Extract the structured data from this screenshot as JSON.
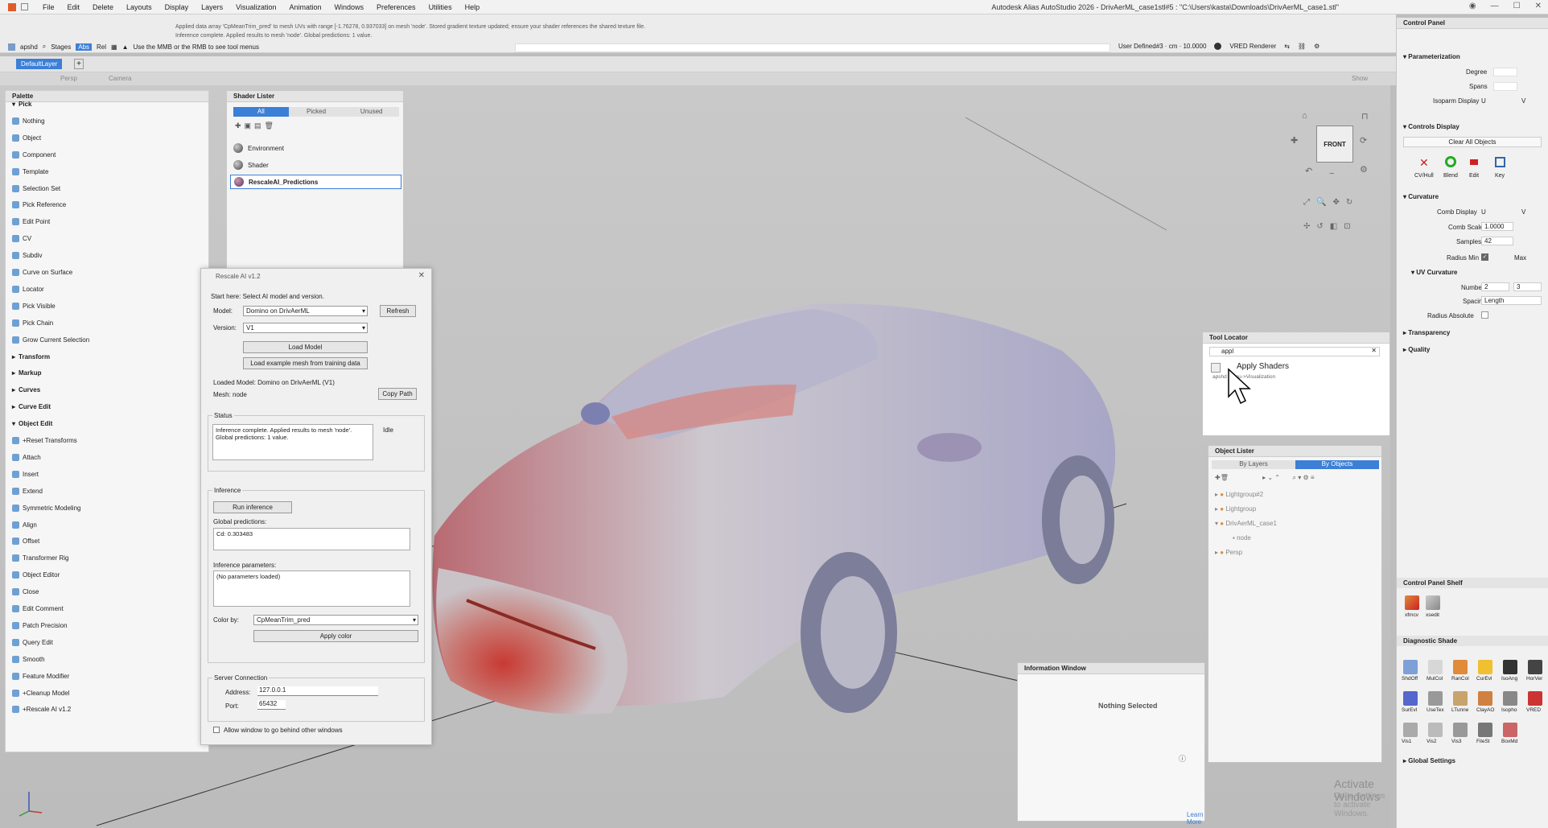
{
  "menubar": {
    "items": [
      "File",
      "Edit",
      "Delete",
      "Layouts",
      "Display",
      "Layers",
      "Visualization",
      "Animation",
      "Windows",
      "Preferences",
      "Utilities",
      "Help"
    ],
    "app_title": "Autodesk Alias AutoStudio 2026   -   DrivAerML_case1stl#5 : \"C:\\Users\\kasta\\Downloads\\DrivAerML_case1.stl\""
  },
  "toolbar": {
    "shelf_label": "apshd",
    "stages_label": "Stages",
    "abs_label": "Abs",
    "rel_label": "Rel",
    "hint": "Use the MMB or the RMB to see tool menus",
    "messages": [
      "Applied data array 'CpMeanTrim_pred' to mesh UVs with range [-1.76278, 0.937033] on mesh 'node'. Stored gradient texture updated; ensure your shader references the shared texture file.",
      "Inference complete. Applied results to mesh 'node'. Global predictions: 1 value."
    ],
    "right_info": "User Defined#3  ·  cm  ·  10.0000",
    "renderer": "VRED Renderer"
  },
  "layer_bar": {
    "default_layer": "DefaultLayer"
  },
  "viewport_bar": {
    "persp": "Persp",
    "camera": "Camera",
    "show": "Show"
  },
  "palette": {
    "title": "Palette",
    "rows": [
      {
        "label": "Pick",
        "header": true
      },
      {
        "label": "Nothing"
      },
      {
        "label": "Object"
      },
      {
        "label": "Component"
      },
      {
        "label": "Template"
      },
      {
        "label": "Selection Set"
      },
      {
        "label": "Pick Reference"
      },
      {
        "label": "Edit Point"
      },
      {
        "label": "CV"
      },
      {
        "label": "Subdiv"
      },
      {
        "label": "Curve on Surface"
      },
      {
        "label": "Locator"
      },
      {
        "label": "Pick Visible"
      },
      {
        "label": "Pick Chain"
      },
      {
        "label": "Grow Current Selection"
      },
      {
        "label": "Transform",
        "header": true
      },
      {
        "label": "Markup",
        "header": true
      },
      {
        "label": "Curves",
        "header": true
      },
      {
        "label": "Curve Edit",
        "header": true
      },
      {
        "label": "Object Edit",
        "header": true
      },
      {
        "label": "+Reset Transforms"
      },
      {
        "label": "Attach"
      },
      {
        "label": "Insert"
      },
      {
        "label": "Extend"
      },
      {
        "label": "Symmetric Modeling"
      },
      {
        "label": "Align"
      },
      {
        "label": "Offset"
      },
      {
        "label": "Transformer Rig"
      },
      {
        "label": "Object Editor"
      },
      {
        "label": "Close"
      },
      {
        "label": "Edit Comment"
      },
      {
        "label": "Patch Precision"
      },
      {
        "label": "Query Edit"
      },
      {
        "label": "Smooth"
      },
      {
        "label": "Feature Modifier"
      },
      {
        "label": "+Cleanup Model"
      },
      {
        "label": "+Rescale AI v1.2"
      }
    ]
  },
  "shader_lister": {
    "title": "Shader Lister",
    "tabs": [
      "All",
      "Picked",
      "Unused"
    ],
    "items": [
      "Environment",
      "Shader",
      "RescaleAI_Predictions"
    ]
  },
  "rescale_dialog": {
    "title": "Rescale AI v1.2",
    "start_here": "Start here: Select AI model and version.",
    "model_label": "Model:",
    "model_value": "Domino on DrivAerML",
    "refresh": "Refresh",
    "version_label": "Version:",
    "version_value": "V1",
    "load_model": "Load Model",
    "load_example": "Load example mesh from training data",
    "loaded_model": "Loaded Model: Domino on DrivAerML (V1)",
    "mesh": "Mesh: node",
    "copy_path": "Copy Path",
    "status_title": "Status",
    "status_text": "Inference complete. Applied results to mesh 'node'. Global predictions: 1 value.",
    "status_state": "Idle",
    "inference_title": "Inference",
    "run_inference": "Run inference",
    "global_predictions_label": "Global predictions:",
    "global_predictions_value": "Cd: 0.303483",
    "inference_params_label": "Inference parameters:",
    "inference_params_value": "(No parameters loaded)",
    "color_by_label": "Color by:",
    "color_by_value": "CpMeanTrim_pred",
    "apply_color": "Apply color",
    "server_title": "Server Connection",
    "address_label": "Address:",
    "address_value": "127.0.0.1",
    "port_label": "Port:",
    "port_value": "65432",
    "allow_behind": "Allow window to go behind other windows"
  },
  "control_panel": {
    "title": "Control Panel",
    "parameterization": "Parameterization",
    "degree": "Degree",
    "spans": "Spans",
    "isoparm_display": "Isoparm Display",
    "u": "U",
    "v": "V",
    "controls_display": "Controls Display",
    "clear_all": "Clear All Objects",
    "icons": [
      "CV/Hull",
      "Blend",
      "Edit",
      "Key"
    ],
    "curvature": "Curvature",
    "comb_display": "Comb Display",
    "comb_scale_label": "Comb Scale",
    "comb_scale": "1.0000",
    "samples_label": "Samples",
    "samples": "42",
    "radius_min": "Radius Min",
    "max": "Max",
    "uv_curvature": "UV Curvature",
    "number_label": "Number",
    "number_u": "2",
    "number_v": "3",
    "spacing_label": "Spacing",
    "spacing_value": "Length",
    "radius_absolute": "Radius Absolute",
    "transparency": "Transparency",
    "quality": "Quality",
    "shelf_title": "Control Panel Shelf",
    "shelf_items": [
      "xfmcv",
      "xsedit"
    ],
    "diag_title": "Diagnostic Shade",
    "diag_row1": [
      "ShdOff",
      "MulCol",
      "RanCol",
      "CurEvl",
      "IsoAng",
      "HorVer"
    ],
    "diag_row2": [
      "SurEvl",
      "UseTex",
      "LTunne",
      "ClayAO",
      "Isopho",
      "VRED"
    ],
    "diag_row3": [
      "Vis1",
      "Vis2",
      "Vis3",
      "FileSt",
      "BoxMd"
    ],
    "global_settings": "Global Settings"
  },
  "tool_locator": {
    "title": "Tool Locator",
    "search": "appl",
    "result": "Apply Shaders",
    "result_path": "apshd  Menu->Visualization"
  },
  "object_lister": {
    "title": "Object Lister",
    "tabs": [
      "By Layers",
      "By Objects"
    ],
    "items": [
      "Lightgroup#2",
      "Lightgroup",
      "DrivAerML_case1",
      "node",
      "Persp"
    ]
  },
  "info_window": {
    "title": "Information Window",
    "text": "Nothing Selected",
    "learn_more": "Learn More"
  },
  "viewcube": {
    "label": "FRONT"
  },
  "watermark": {
    "line1": "Activate Windows",
    "line2": "Go to Settings to activate Windows."
  }
}
